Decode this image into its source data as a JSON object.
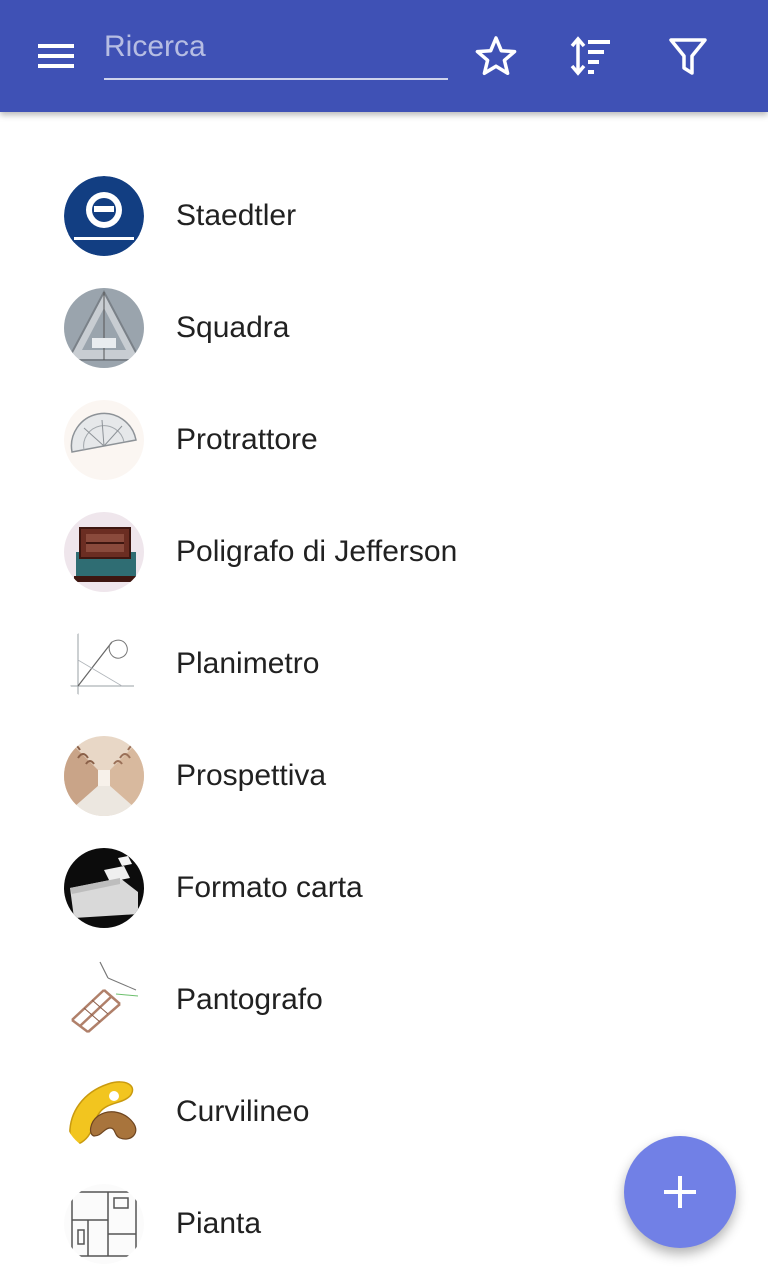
{
  "toolbar": {
    "search_placeholder": "Ricerca",
    "menu_icon": "hamburger-menu-icon",
    "favorites_icon": "star-outline-icon",
    "sort_icon": "sort-icon",
    "filter_icon": "filter-icon",
    "bg_color": "#3f51b5"
  },
  "items": [
    {
      "label": "Staedtler",
      "thumbnail": "staedtler-logo"
    },
    {
      "label": "Squadra",
      "thumbnail": "set-square-photo"
    },
    {
      "label": "Protrattore",
      "thumbnail": "protractor-photo"
    },
    {
      "label": "Poligrafo di Jefferson",
      "thumbnail": "polygraph-photo"
    },
    {
      "label": "Planimetro",
      "thumbnail": "planimeter-drawing"
    },
    {
      "label": "Prospettiva",
      "thumbnail": "arcade-perspective-photo"
    },
    {
      "label": "Formato carta",
      "thumbnail": "paper-format-photo"
    },
    {
      "label": "Pantografo",
      "thumbnail": "pantograph-drawing"
    },
    {
      "label": "Curvilineo",
      "thumbnail": "french-curve-photo"
    },
    {
      "label": "Pianta",
      "thumbnail": "floor-plan-drawing"
    }
  ],
  "fab": {
    "icon": "plus-icon",
    "color": "#7180e6"
  }
}
